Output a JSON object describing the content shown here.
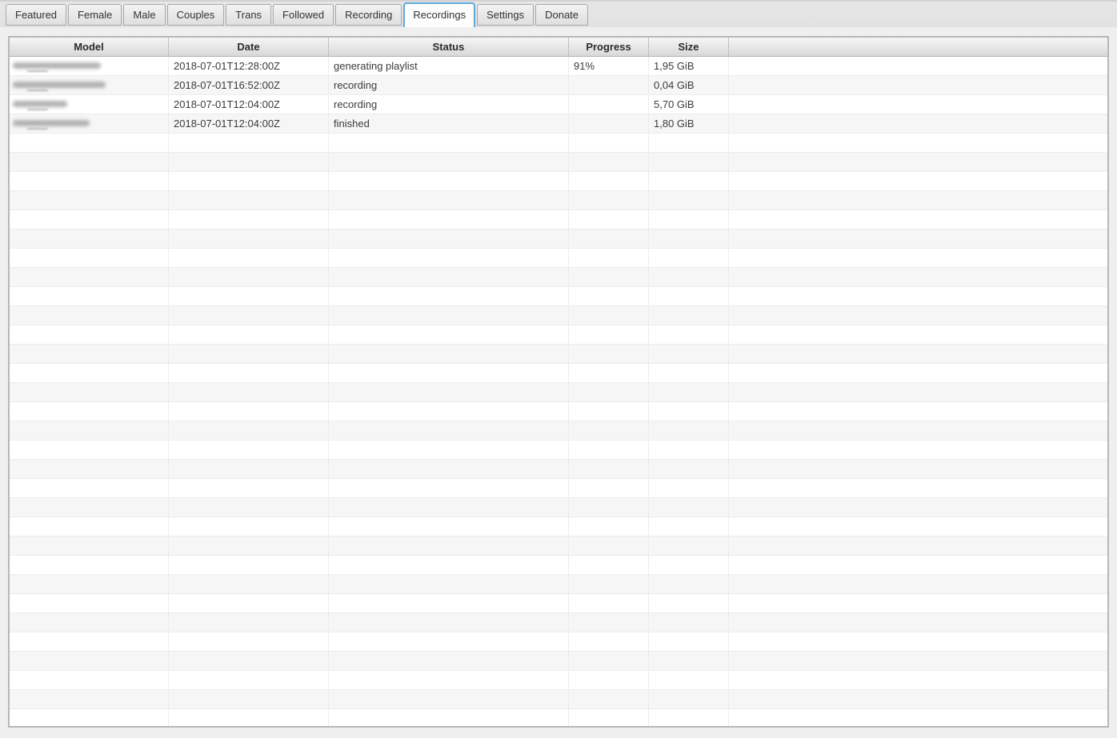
{
  "tabs": [
    {
      "label": "Featured",
      "active": false
    },
    {
      "label": "Female",
      "active": false
    },
    {
      "label": "Male",
      "active": false
    },
    {
      "label": "Couples",
      "active": false
    },
    {
      "label": "Trans",
      "active": false
    },
    {
      "label": "Followed",
      "active": false
    },
    {
      "label": "Recording",
      "active": false
    },
    {
      "label": "Recordings",
      "active": true
    },
    {
      "label": "Settings",
      "active": false
    },
    {
      "label": "Donate",
      "active": false
    }
  ],
  "table": {
    "columns": [
      "Model",
      "Date",
      "Status",
      "Progress",
      "Size",
      ""
    ],
    "rows": [
      {
        "model_redacted": true,
        "redacted_width": 110,
        "date": "2018-07-01T12:28:00Z",
        "status": "generating playlist",
        "progress": "91%",
        "size": "1,95 GiB"
      },
      {
        "model_redacted": true,
        "redacted_width": 116,
        "date": "2018-07-01T16:52:00Z",
        "status": "recording",
        "progress": "",
        "size": "0,04 GiB"
      },
      {
        "model_redacted": true,
        "redacted_width": 68,
        "date": "2018-07-01T12:04:00Z",
        "status": "recording",
        "progress": "",
        "size": "5,70 GiB"
      },
      {
        "model_redacted": true,
        "redacted_width": 96,
        "date": "2018-07-01T12:04:00Z",
        "status": "finished",
        "progress": "",
        "size": "1,80 GiB"
      }
    ],
    "empty_row_count": 31
  },
  "colors": {
    "active_tab_border": "#5fa8d8",
    "background": "#efefef",
    "row_stripe": "#f6f6f6",
    "header_text": "#2b2b2b"
  }
}
